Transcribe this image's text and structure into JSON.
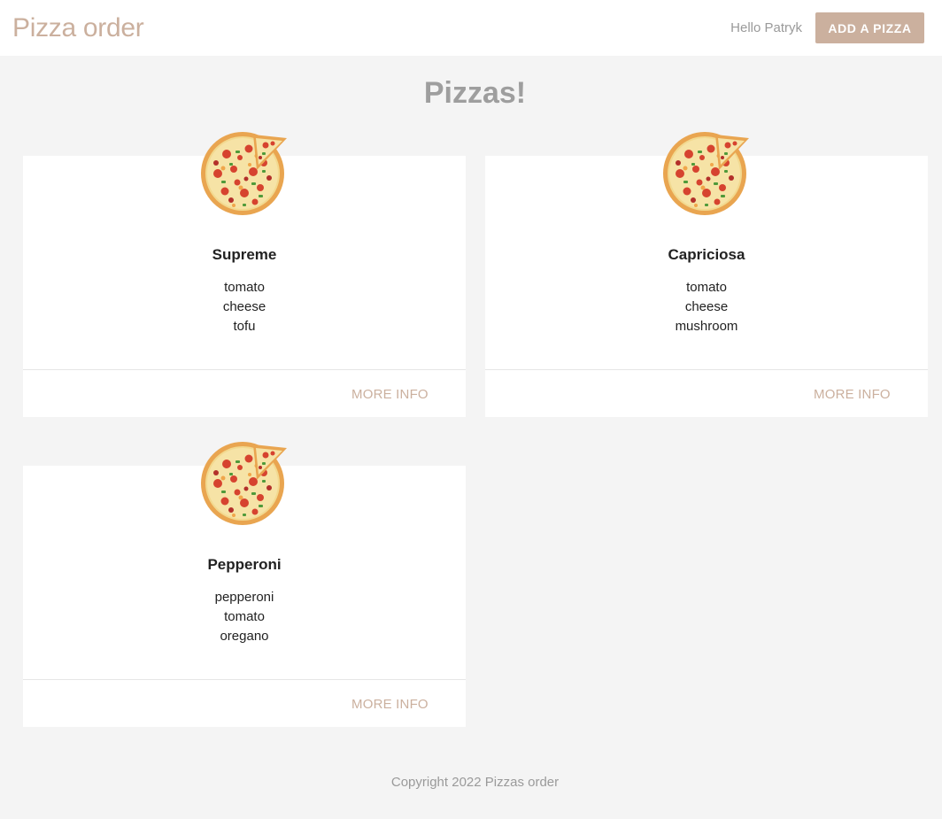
{
  "navbar": {
    "brand": "Pizza order",
    "greeting": "Hello Patryk",
    "add_button": "ADD A PIZZA"
  },
  "page_title": "Pizzas!",
  "pizzas": [
    {
      "name": "Supreme",
      "ingredients": [
        "tomato",
        "cheese",
        "tofu"
      ],
      "link": "MORE INFO"
    },
    {
      "name": "Capriciosa",
      "ingredients": [
        "tomato",
        "cheese",
        "mushroom"
      ],
      "link": "MORE INFO"
    },
    {
      "name": "Pepperoni",
      "ingredients": [
        "pepperoni",
        "tomato",
        "oregano"
      ],
      "link": "MORE INFO"
    }
  ],
  "footer": "Copyright 2022 Pizzas order",
  "colors": {
    "accent": "#cbb09e",
    "background": "#f4f4f4",
    "muted_text": "#9a9a9a"
  },
  "icons": {
    "pizza_image": "pizza-image"
  }
}
